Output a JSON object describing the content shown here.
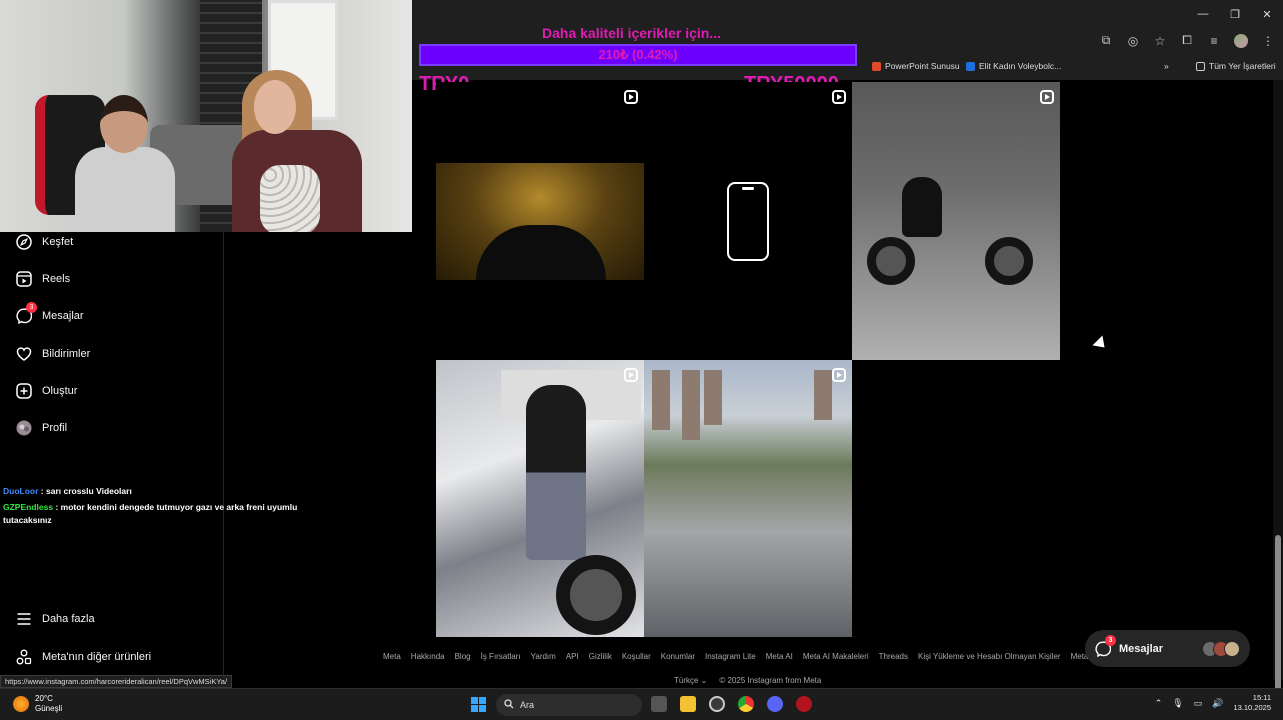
{
  "donation": {
    "title": "Daha kaliteli içerikler için...",
    "value_text": "210₺ (0.42%)",
    "progress_fraction": 0.0042,
    "min_label": "TRY0",
    "max_label": "TRY50000"
  },
  "bookmarks": [
    {
      "label": "PowerPoint Sunusu",
      "color": "#e34a2a"
    },
    {
      "label": "Elit Kadın Voleybolc...",
      "color": "#1e6fe0"
    },
    {
      "label": "Tüm Yer İşaretleri",
      "color": "#cccccc"
    }
  ],
  "sidebar": {
    "items": [
      {
        "label": "Keşfet",
        "icon": "compass-icon"
      },
      {
        "label": "Reels",
        "icon": "reels-icon"
      },
      {
        "label": "Mesajlar",
        "icon": "messenger-icon",
        "badge": "3"
      },
      {
        "label": "Bildirimler",
        "icon": "heart-icon"
      },
      {
        "label": "Oluştur",
        "icon": "plus-square-icon"
      },
      {
        "label": "Profil",
        "icon": "profile-avatar"
      }
    ],
    "more_label": "Daha fazla",
    "meta_products_label": "Meta'nın diğer ürünleri"
  },
  "chat": [
    {
      "user": "DuoLoor",
      "text": ": sarı crosslu Videoları"
    },
    {
      "user": "GZPEndless",
      "text": ": motor kendini dengede tutmuyor gazı ve arka freni uyumlu tutacaksınız"
    }
  ],
  "footer": {
    "links": [
      "Meta",
      "Hakkında",
      "Blog",
      "İş Fırsatları",
      "Yardım",
      "API",
      "Gizlilik",
      "Koşullar",
      "Konumlar",
      "Instagram Lite",
      "Meta AI",
      "Meta AI Makaleleri",
      "Threads",
      "Kişi Yükleme ve Hesabı Olmayan Kişiler",
      "Meta"
    ],
    "language": "Türkçe ⌄",
    "copyright": "© 2025 Instagram from Meta"
  },
  "messages_pill": {
    "label": "Mesajlar",
    "badge": "3"
  },
  "status_url": "https://www.instagram.com/harcorerideralican/reel/DPqVwMSiKYa/",
  "taskbar": {
    "temperature": "20°C",
    "weather": "Güneşli",
    "search_placeholder": "Ara",
    "time": "15:11",
    "date": "13.10.2025"
  },
  "colors": {
    "accent_pink": "#e01bb4",
    "bar_purple": "#6d00ff",
    "badge_red": "#ff3040"
  }
}
